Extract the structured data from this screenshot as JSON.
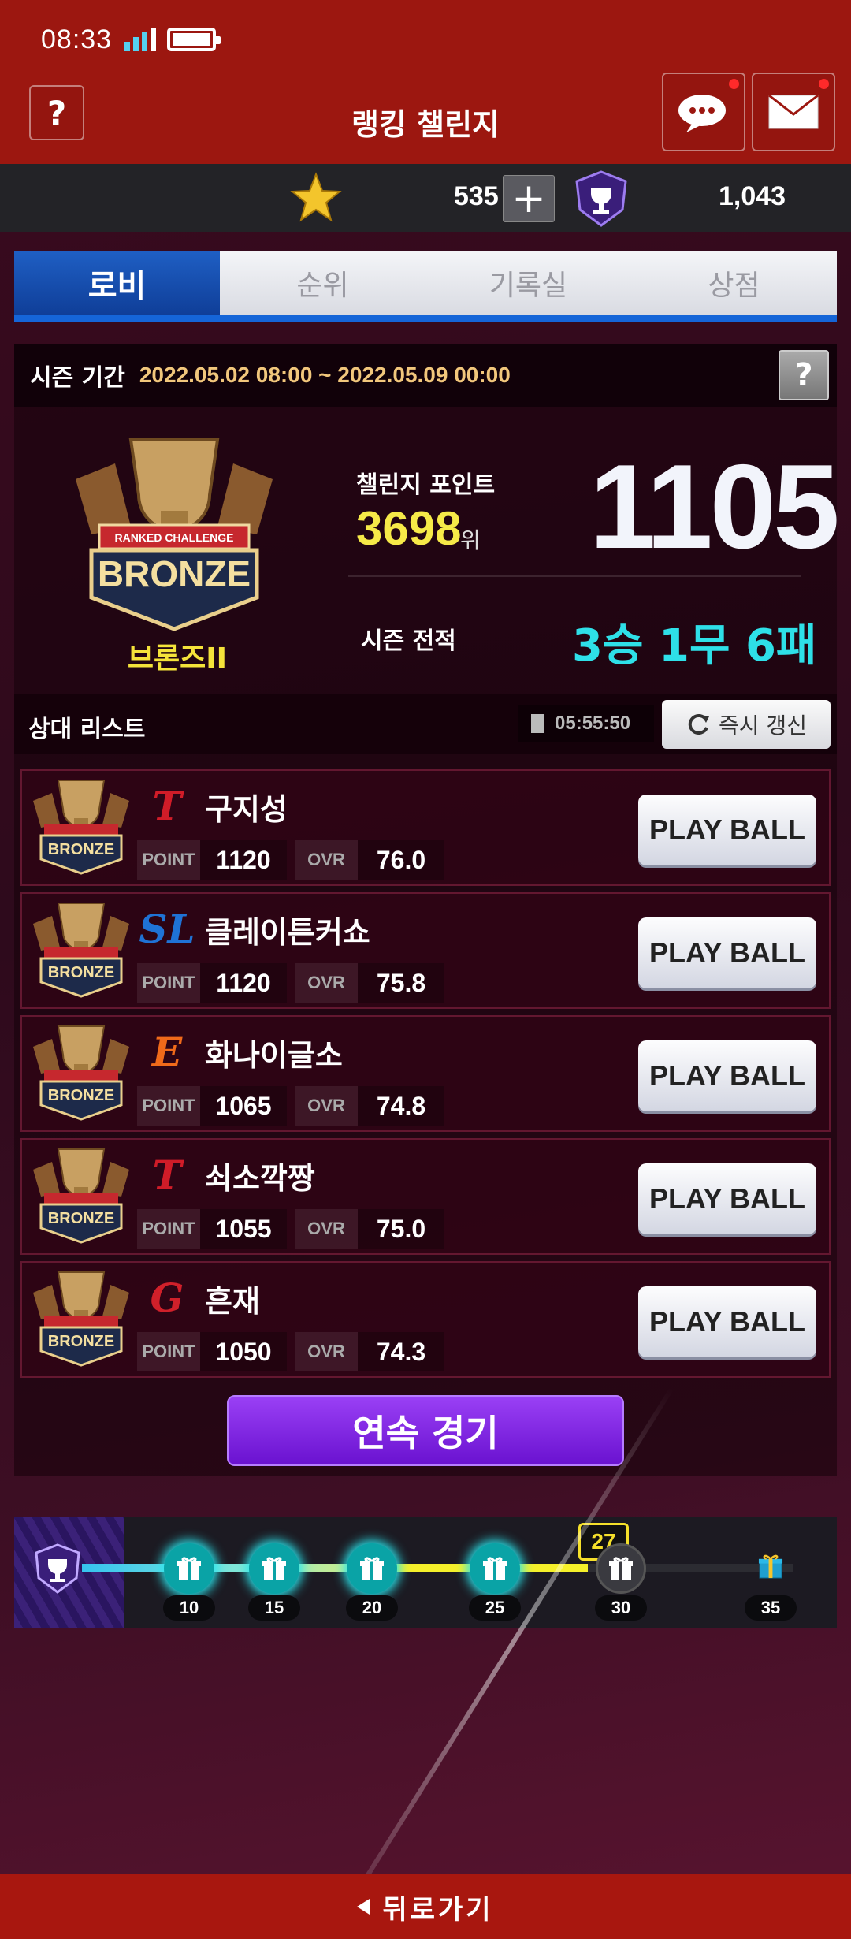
{
  "status_bar": {
    "time": "08:33"
  },
  "header": {
    "title": "랭킹 챌린지",
    "help_label": "?"
  },
  "currency": {
    "stars": "535",
    "plus_label": "+",
    "trophies": "1,043"
  },
  "tabs": [
    {
      "label": "로비",
      "active": true
    },
    {
      "label": "순위",
      "active": false
    },
    {
      "label": "기록실",
      "active": false
    },
    {
      "label": "상점",
      "active": false
    }
  ],
  "season": {
    "label": "시즌 기간",
    "dates": "2022.05.02 08:00 ~ 2022.05.09 00:00",
    "help_label": "?",
    "tier_name": "브론즈II",
    "emblem_text": "BRONZE",
    "emblem_ribbon": "RANKED CHALLENGE",
    "challenge_points_label": "챌린지 포인트",
    "rank": "3698",
    "rank_unit": "위",
    "points": "1105",
    "record_label": "시즌 전적",
    "record": "3승 1무 6패"
  },
  "opponents": {
    "title": "상대 리스트",
    "timer": "05:55:50",
    "refresh_label": "즉시 갱신",
    "point_key": "POINT",
    "ovr_key": "OVR",
    "play_label": "PLAY BALL",
    "rows": [
      {
        "name": "구지성",
        "team_mark": "T",
        "team_color": "#d01c28",
        "point": "1120",
        "ovr": "76.0"
      },
      {
        "name": "클레이튼커쇼",
        "team_mark": "SL",
        "team_color": "#1f73d6",
        "point": "1120",
        "ovr": "75.8"
      },
      {
        "name": "화나이글소",
        "team_mark": "E",
        "team_color": "#f06a1a",
        "point": "1065",
        "ovr": "74.8"
      },
      {
        "name": "쇠소깍짱",
        "team_mark": "T",
        "team_color": "#d01c28",
        "point": "1055",
        "ovr": "75.0"
      },
      {
        "name": "흔재",
        "team_mark": "G",
        "team_color": "#d0202a",
        "point": "1050",
        "ovr": "74.3"
      }
    ]
  },
  "continuous_label": "연속 경기",
  "progress": {
    "current": "27",
    "milestones": [
      {
        "value": "10",
        "reached": true
      },
      {
        "value": "15",
        "reached": true
      },
      {
        "value": "20",
        "reached": true
      },
      {
        "value": "25",
        "reached": true
      },
      {
        "value": "30",
        "reached": false
      },
      {
        "value": "35",
        "reached": false
      }
    ]
  },
  "back_label": "뒤로가기",
  "colors": {
    "header_red": "#9c1710",
    "accent_cyan": "#2ee0e8",
    "accent_yellow": "#f6ea48",
    "tab_blue": "#1565d8",
    "purple_button": "#7a22e0"
  }
}
